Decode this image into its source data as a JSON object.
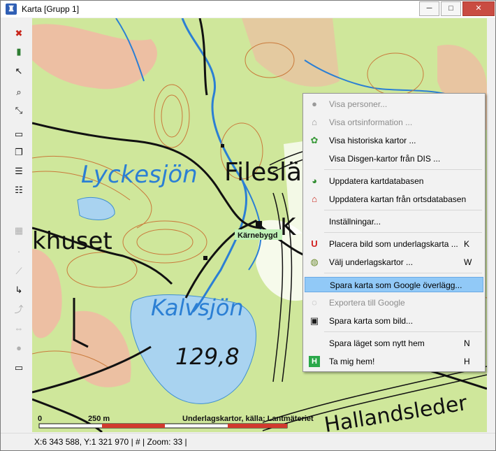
{
  "window": {
    "title": "Karta [Grupp 1]"
  },
  "controls": {
    "minimize": "─",
    "maximize": "□",
    "close": "✕"
  },
  "toolbar": {
    "tools": [
      {
        "name": "close-map-icon",
        "glyph": "✖",
        "enabled": true
      },
      {
        "name": "layers-icon",
        "glyph": "▮",
        "enabled": true
      },
      {
        "name": "pointer-icon",
        "glyph": "↖",
        "enabled": true
      },
      {
        "name": "zoom-icon",
        "glyph": "⌕",
        "enabled": true
      },
      {
        "name": "measure-icon",
        "glyph": "⤡",
        "enabled": true
      },
      {
        "name": "ruler-icon",
        "glyph": "▭",
        "enabled": true
      },
      {
        "name": "copy-icon",
        "glyph": "❐",
        "enabled": true
      },
      {
        "name": "list-icon",
        "glyph": "☰",
        "enabled": true
      },
      {
        "name": "grid-icon",
        "glyph": "☷",
        "enabled": true
      },
      {
        "name": "table-icon",
        "glyph": "▦",
        "enabled": false
      },
      {
        "name": "point-icon",
        "glyph": "·",
        "enabled": false
      },
      {
        "name": "line-icon",
        "glyph": "⟋",
        "enabled": false
      },
      {
        "name": "route-icon",
        "glyph": "↳",
        "enabled": true
      },
      {
        "name": "path-icon",
        "glyph": "⤴",
        "enabled": false
      },
      {
        "name": "move-icon",
        "glyph": "⇔",
        "enabled": false
      },
      {
        "name": "circle-icon",
        "glyph": "●",
        "enabled": false
      },
      {
        "name": "frame-icon",
        "glyph": "▭",
        "enabled": true
      }
    ]
  },
  "map": {
    "labels": {
      "lake1": "Lyckesjön",
      "lake2": "Kalvsjön",
      "place1": "Fileslä",
      "place2": "khuset",
      "place3": "K",
      "elevation": "129,8",
      "settlement": "Kärnebygd",
      "trail": "Hallandsleder"
    },
    "scale": {
      "start": "0",
      "distance": "250 m",
      "source": "Underlagskartor, källa: Lantmäteriet"
    },
    "colors": {
      "land": "#cfe79b",
      "water": "#a9d3f0",
      "contour": "#c9793a",
      "urban": "#f3b4a2"
    }
  },
  "status": {
    "text": "X:6 343 588, Y:1 321 970  |  #  |  Zoom: 33  |"
  },
  "context_menu": {
    "items": [
      {
        "label": "Visa personer...",
        "icon": "person-icon",
        "glyph": "●",
        "disabled": true,
        "shortcut": ""
      },
      {
        "label": "Visa ortsinformation ...",
        "icon": "house-icon",
        "glyph": "⌂",
        "disabled": true,
        "shortcut": ""
      },
      {
        "label": "Visa historiska kartor ...",
        "icon": "clover-icon",
        "glyph": "✿",
        "disabled": false,
        "shortcut": ""
      },
      {
        "label": "Visa Disgen-kartor från DIS ...",
        "icon": "",
        "glyph": "",
        "disabled": false,
        "shortcut": ""
      },
      {
        "label": "Uppdatera kartdatabasen",
        "icon": "refresh-icon",
        "glyph": "◕",
        "disabled": false,
        "shortcut": ""
      },
      {
        "label": "Uppdatera kartan från ortsdatabasen",
        "icon": "house-update-icon",
        "glyph": "⌂",
        "disabled": false,
        "shortcut": ""
      },
      {
        "label": "Inställningar...",
        "icon": "",
        "glyph": "",
        "disabled": false,
        "shortcut": ""
      },
      {
        "label": "Placera bild som underlagskarta ...",
        "icon": "magnet-icon",
        "glyph": "U",
        "disabled": false,
        "shortcut": "K"
      },
      {
        "label": "Välj underlagskartor ...",
        "icon": "map-select-icon",
        "glyph": "◍",
        "disabled": false,
        "shortcut": "W"
      },
      {
        "label": "Spara karta som Google överlägg...",
        "icon": "",
        "glyph": "",
        "disabled": false,
        "shortcut": "",
        "highlighted": true
      },
      {
        "label": "Exportera till Google",
        "icon": "globe-icon",
        "glyph": "◌",
        "disabled": true,
        "shortcut": ""
      },
      {
        "label": "Spara karta som bild...",
        "icon": "floppy-icon",
        "glyph": "▣",
        "disabled": false,
        "shortcut": ""
      },
      {
        "label": "Spara läget som nytt hem",
        "icon": "",
        "glyph": "",
        "disabled": false,
        "shortcut": "N"
      },
      {
        "label": "Ta mig hem!",
        "icon": "home-h-icon",
        "glyph": "H",
        "disabled": false,
        "shortcut": "H"
      }
    ]
  }
}
